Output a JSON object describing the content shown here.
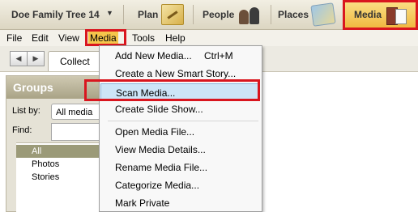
{
  "toolbar": {
    "tree_title": "Doe Family Tree 14",
    "tabs": [
      {
        "label": "Plan",
        "icon": "plan-icon"
      },
      {
        "label": "People",
        "icon": "people-icon"
      },
      {
        "label": "Places",
        "icon": "places-icon"
      },
      {
        "label": "Media",
        "icon": "media-icon",
        "active": true
      }
    ]
  },
  "menubar": {
    "items": [
      "File",
      "Edit",
      "View",
      "Media",
      "Tools",
      "Help"
    ],
    "active": "Media"
  },
  "nav": {
    "tab_label": "Collect"
  },
  "groups": {
    "title": "Groups",
    "list_by_label": "List by:",
    "list_by_value": "All media",
    "find_label": "Find:",
    "items": [
      "All",
      "Photos",
      "Stories"
    ],
    "selected": "All"
  },
  "media_menu": {
    "items": [
      {
        "label": "Add New Media...",
        "shortcut": "Ctrl+M"
      },
      {
        "label": "Create a New Smart Story..."
      },
      {
        "label": "Scan Media...",
        "highlighted": true
      },
      {
        "label": "Create Slide Show..."
      },
      {
        "label": "Open Media File..."
      },
      {
        "label": "View Media Details..."
      },
      {
        "label": "Rename Media File..."
      },
      {
        "label": "Categorize Media..."
      },
      {
        "label": "Mark Private"
      }
    ]
  },
  "colors": {
    "highlight_border": "#d9161f",
    "active_tab": "#f0b63c",
    "menu_hover": "#cde5f7"
  }
}
